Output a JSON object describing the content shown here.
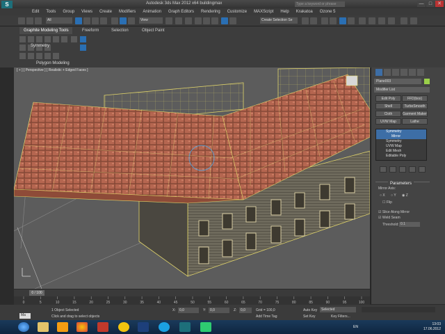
{
  "titlebar": {
    "title": "Autodesk 3ds Max 2012 x64     buildingmax",
    "search_placeholder": "Type a keyword or phrase",
    "minimize": "—",
    "maximize": "□",
    "close": "✕"
  },
  "menu": [
    "Edit",
    "Tools",
    "Group",
    "Views",
    "Create",
    "Modifiers",
    "Animation",
    "Graph Editors",
    "Rendering",
    "Customize",
    "MAXScript",
    "Help",
    "Krakatoa",
    "Ozone 5"
  ],
  "toolbar": {
    "selection_filter": "All",
    "reference_coord": "View",
    "named_selection": "Create Selection Se"
  },
  "ribbon": {
    "tabs": [
      "Graphite Modeling Tools",
      "Freeform",
      "Selection",
      "Object Paint"
    ],
    "symmetry_label": "Symmetry",
    "panel_label": "Polygon Modeling"
  },
  "viewport": {
    "label": "[ + ] [ Perspective ] [ Realistic + Edged Faces ]"
  },
  "command_panel": {
    "object_name": "Plane003",
    "modifier_list": "Modifier List",
    "buttons": [
      "Edit Poly",
      "FFD(box)",
      "Shell",
      "TurboSmooth",
      "Cloth",
      "Garment Maker",
      "UVW Map",
      "Lathe"
    ],
    "stack": [
      "Symmetry",
      "Mirror",
      "Symmetry",
      "UVW Map",
      "Edit Mesh",
      "Editable Poly"
    ],
    "parameters_title": "Parameters",
    "mirror_axis_label": "Mirror Axis:",
    "axes": [
      "X",
      "Y",
      "Z"
    ],
    "flip_label": "Flip",
    "slice_label": "Slice Along Mirror",
    "weld_label": "Weld Seam",
    "threshold_label": "Threshold:",
    "threshold_value": "0.1"
  },
  "timeline": {
    "frame": "0 / 100",
    "ticks": [
      "0",
      "5",
      "10",
      "15",
      "20",
      "25",
      "30",
      "35",
      "40",
      "45",
      "50",
      "55",
      "60",
      "65",
      "70",
      "75",
      "80",
      "85",
      "90",
      "95",
      "100"
    ]
  },
  "status": {
    "selected": "1 Object Selected",
    "hint": "Click and drag to select objects",
    "x_label": "X:",
    "x_value": "0,0",
    "y_label": "Y:",
    "y_value": "0,0",
    "z_label": "Z:",
    "z_value": "0,0",
    "grid": "Grid = 100,0",
    "auto_key": "Auto Key",
    "set_key": "Set Key",
    "selected_dropdown": "Selected",
    "key_filters": "Key Filters...",
    "add_time_tag": "Add Time Tag",
    "maxscript_label": "Ma"
  },
  "taskbar": {
    "time": "13:03",
    "date": "17.06.2012",
    "lang": "EN"
  },
  "colors": {
    "accent": "#3d6ea6",
    "wire": "#e8d86a",
    "roof": "#b0604a"
  }
}
